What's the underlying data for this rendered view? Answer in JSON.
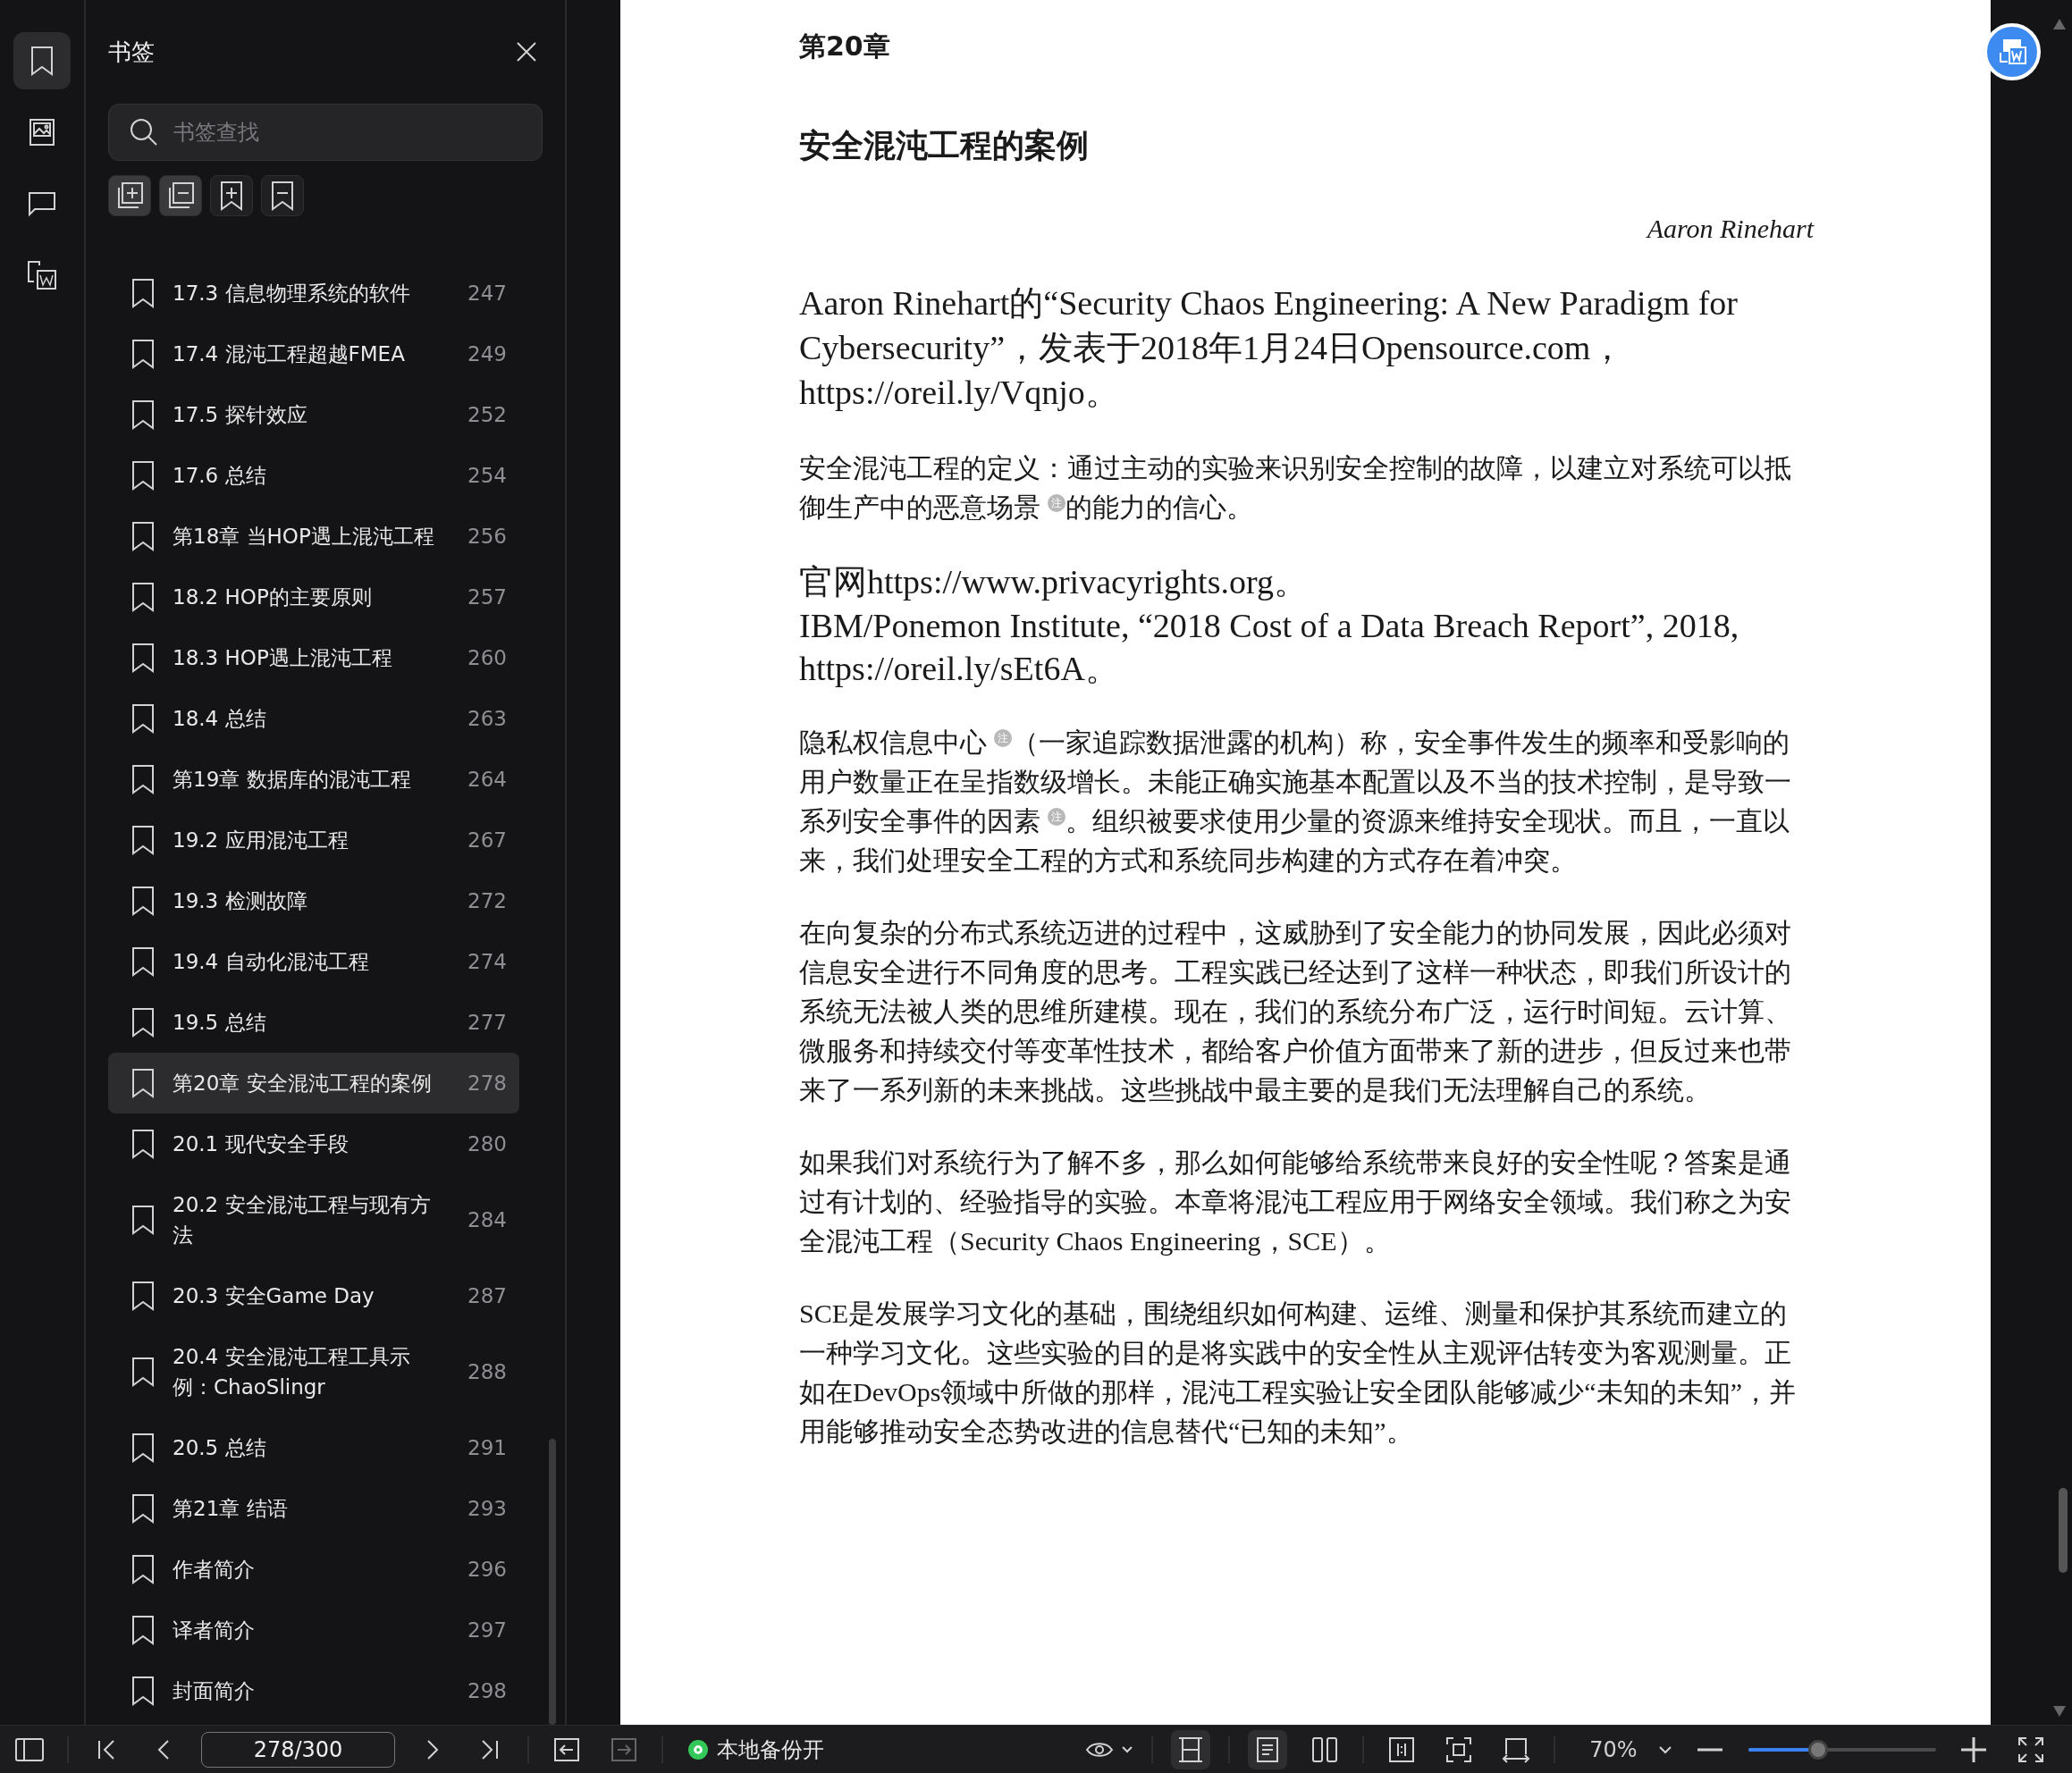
{
  "rail": [
    {
      "kind": "bookmarks",
      "selected": true
    },
    {
      "kind": "images",
      "selected": false
    },
    {
      "kind": "comments",
      "selected": false
    },
    {
      "kind": "convert",
      "selected": false
    }
  ],
  "panel": {
    "title": "书签",
    "search": {
      "placeholder": "书签查找"
    },
    "tools": [
      {
        "kind": "expand",
        "highlighted": true
      },
      {
        "kind": "collapse",
        "highlighted": true
      },
      {
        "kind": "add",
        "highlighted": false
      },
      {
        "kind": "remove",
        "highlighted": false
      }
    ],
    "bookmarks": [
      {
        "title": "17.3 信息物理系统的软件",
        "page": "247",
        "selected": false
      },
      {
        "title": "17.4 混沌工程超越FMEA",
        "page": "249",
        "selected": false
      },
      {
        "title": "17.5 探针效应",
        "page": "252",
        "selected": false
      },
      {
        "title": "17.6 总结",
        "page": "254",
        "selected": false
      },
      {
        "title": "第18章 当HOP遇上混沌工程",
        "page": "256",
        "selected": false
      },
      {
        "title": "18.2 HOP的主要原则",
        "page": "257",
        "selected": false
      },
      {
        "title": "18.3 HOP遇上混沌工程",
        "page": "260",
        "selected": false
      },
      {
        "title": "18.4 总结",
        "page": "263",
        "selected": false
      },
      {
        "title": "第19章 数据库的混沌工程",
        "page": "264",
        "selected": false
      },
      {
        "title": "19.2 应用混沌工程",
        "page": "267",
        "selected": false
      },
      {
        "title": "19.3 检测故障",
        "page": "272",
        "selected": false
      },
      {
        "title": "19.4 自动化混沌工程",
        "page": "274",
        "selected": false
      },
      {
        "title": "19.5 总结",
        "page": "277",
        "selected": false
      },
      {
        "title": "第20章 安全混沌工程的案例",
        "page": "278",
        "selected": true
      },
      {
        "title": "20.1 现代安全手段",
        "page": "280",
        "selected": false
      },
      {
        "title": "20.2 安全混沌工程与现有方法",
        "page": "284",
        "selected": false
      },
      {
        "title": "20.3 安全Game Day",
        "page": "287",
        "selected": false
      },
      {
        "title": "20.4 安全混沌工程工具示例：ChaoSlingr",
        "page": "288",
        "selected": false
      },
      {
        "title": "20.5 总结",
        "page": "291",
        "selected": false
      },
      {
        "title": "第21章 结语",
        "page": "293",
        "selected": false
      },
      {
        "title": "作者简介",
        "page": "296",
        "selected": false
      },
      {
        "title": "译者简介",
        "page": "297",
        "selected": false
      },
      {
        "title": "封面简介",
        "page": "298",
        "selected": false
      }
    ]
  },
  "document": {
    "chapter_label": "第20章",
    "title": "安全混沌工程的案例",
    "author": "Aaron Rinehart",
    "paragraphs": [
      {
        "kind": "reference",
        "parts": [
          {
            "kind": "text",
            "text": "Aaron Rinehart的“Security Chaos Engineering: A New Paradigm for Cybersecurity”，发表于2018年1月24日Opensource.com，https://oreil.ly/Vqnjo。"
          }
        ]
      },
      {
        "kind": "body",
        "parts": [
          {
            "kind": "text",
            "text": "安全混沌工程的定义：通过主动的实验来识别安全控制的故障，以建立对系统可以抵御生产中的恶意场景 "
          },
          {
            "kind": "note",
            "text": "注"
          },
          {
            "kind": "text",
            "text": "的能力的信心。"
          }
        ]
      },
      {
        "kind": "reference",
        "parts": [
          {
            "kind": "text",
            "text": "官网https://www.privacyrights.org。"
          }
        ]
      },
      {
        "kind": "reference-continued",
        "parts": [
          {
            "kind": "text",
            "text": "IBM/Ponemon Institute, “2018 Cost of a Data Breach Report”, 2018, https://oreil.ly/sEt6A。"
          }
        ]
      },
      {
        "kind": "body",
        "parts": [
          {
            "kind": "text",
            "text": "隐私权信息中心 "
          },
          {
            "kind": "note",
            "text": "注"
          },
          {
            "kind": "text",
            "text": "（一家追踪数据泄露的机构）称，安全事件发生的频率和受影响的用户数量正在呈指数级增长。未能正确实施基本配置以及不当的技术控制，是导致一系列安全事件的因素 "
          },
          {
            "kind": "note",
            "text": "注"
          },
          {
            "kind": "text",
            "text": "。组织被要求使用少量的资源来维持安全现状。而且，一直以来，我们处理安全工程的方式和系统同步构建的方式存在着冲突。"
          }
        ]
      },
      {
        "kind": "body",
        "parts": [
          {
            "kind": "text",
            "text": "在向复杂的分布式系统迈进的过程中，这威胁到了安全能力的协同发展，因此必须对信息安全进行不同角度的思考。工程实践已经达到了这样一种状态，即我们所设计的系统无法被人类的思维所建模。现在，我们的系统分布广泛，运行时间短。云计算、微服务和持续交付等变革性技术，都给客户价值方面带来了新的进步，但反过来也带来了一系列新的未来挑战。这些挑战中最主要的是我们无法理解自己的系统。"
          }
        ]
      },
      {
        "kind": "body",
        "parts": [
          {
            "kind": "text",
            "text": "如果我们对系统行为了解不多，那么如何能够给系统带来良好的安全性呢？答案是通过有计划的、经验指导的实验。本章将混沌工程应用于网络安全领域。我们称之为安全混沌工程（Security Chaos Engineering，SCE）。"
          }
        ]
      },
      {
        "kind": "body",
        "parts": [
          {
            "kind": "text",
            "text": "SCE是发展学习文化的基础，围绕组织如何构建、运维、测量和保护其系统而建立的一种学习文化。这些实验的目的是将实践中的安全性从主观评估转变为客观测量。正如在DevOps领域中所做的那样，混沌工程实验让安全团队能够减少“未知的未知”，并用能够推动安全态势改进的信息替代“已知的未知”。"
          }
        ]
      }
    ]
  },
  "toolbar": {
    "page_input": {
      "value": "278/300"
    },
    "history": [
      {
        "kind": "back",
        "disabled": false
      },
      {
        "kind": "forward",
        "disabled": true
      }
    ],
    "backup": {
      "label": "本地备份开",
      "on": true
    },
    "scroll_modes": [
      {
        "kind": "continuous",
        "selected": true
      }
    ],
    "page_modes": [
      {
        "kind": "single",
        "selected": true
      },
      {
        "kind": "double",
        "selected": false
      }
    ],
    "zoom": {
      "value": "70%",
      "level": 0.37
    }
  }
}
